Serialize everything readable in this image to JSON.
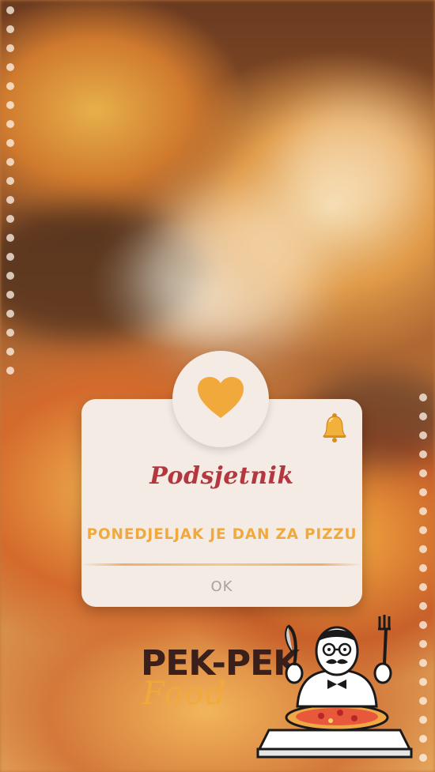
{
  "dialog": {
    "title": "Podsjetnik",
    "message": "PONEDJELJAK JE DAN ZA PIZZU",
    "ok_label": "OK"
  },
  "brand": {
    "name": "PEK-PEK",
    "subtitle": "Food"
  },
  "icons": {
    "heart": "heart-icon",
    "bell": "bell-icon",
    "mascot": "chef-pizza-mascot"
  },
  "colors": {
    "accent_orange": "#f2a93b",
    "title_red": "#b4373f",
    "dialog_bg": "#f4ebe5",
    "ok_gray": "#a8a3a0",
    "brand_dark": "#3a1f1b"
  }
}
